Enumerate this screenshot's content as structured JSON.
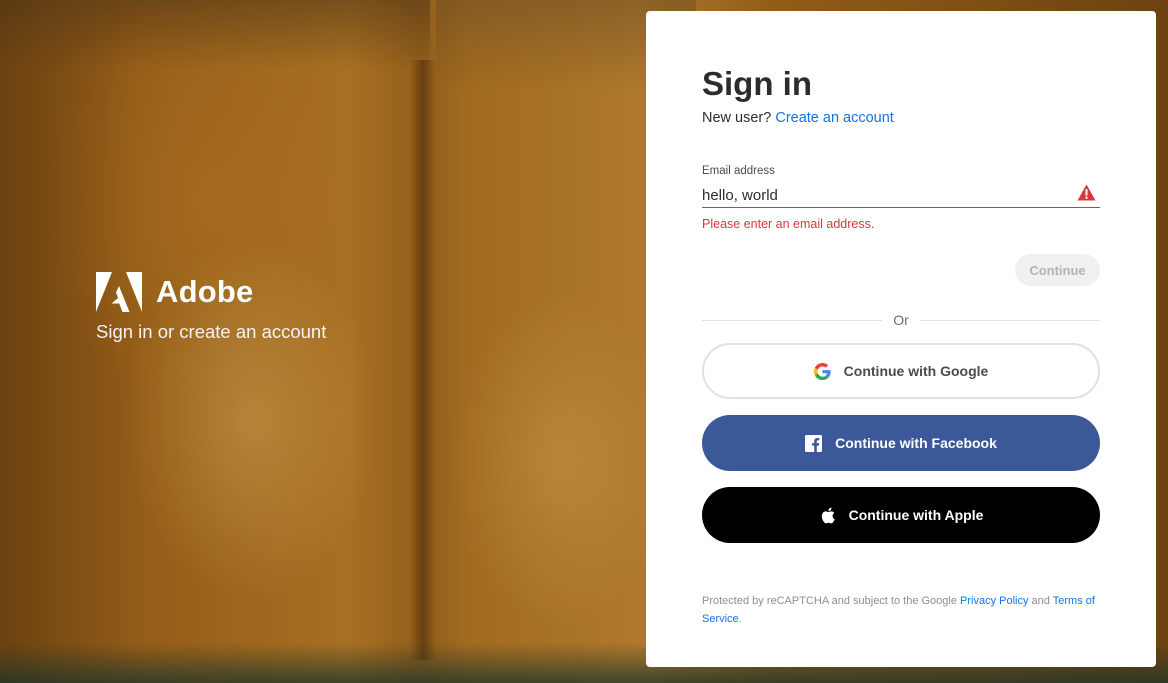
{
  "brand": {
    "name": "Adobe",
    "tagline": "Sign in or create an account",
    "logo_icon": "adobe-logo-icon"
  },
  "signin": {
    "title": "Sign in",
    "new_user_prompt": "New user?",
    "create_account_link": "Create an account",
    "email_label": "Email address",
    "email_value": "hello, world",
    "error_message": "Please enter an email address.",
    "alert_icon": "alert-triangle-icon",
    "continue_label": "Continue",
    "continue_disabled": true,
    "or_label": "Or"
  },
  "social": {
    "google_label": "Continue with Google",
    "facebook_label": "Continue with Facebook",
    "apple_label": "Continue with Apple"
  },
  "legal": {
    "text_before": "Protected by reCAPTCHA and subject to the Google ",
    "privacy_link": "Privacy Policy",
    "text_and": " and ",
    "terms_link": "Terms of Service",
    "text_end": "."
  },
  "colors": {
    "accent_link": "#1473e6",
    "error": "#d7373f",
    "facebook": "#3b5998",
    "apple": "#000000"
  }
}
